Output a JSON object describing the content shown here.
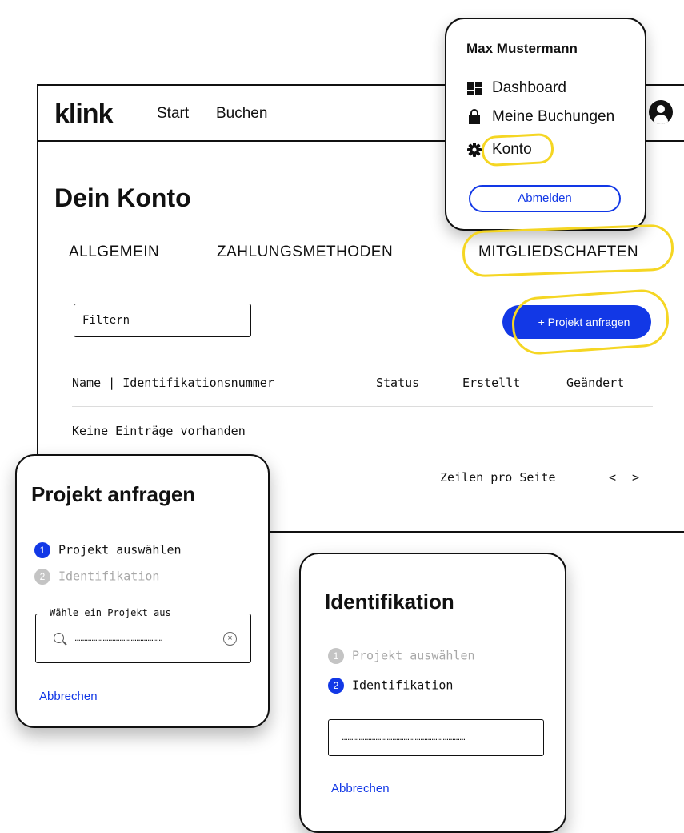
{
  "navbar": {
    "logo": "klink",
    "links": [
      "Start",
      "Buchen"
    ]
  },
  "page": {
    "title": "Dein Konto",
    "tabs": [
      "ALLGEMEIN",
      "ZAHLUNGSMETHODEN",
      "MITGLIEDSCHAFTEN"
    ]
  },
  "toolbar": {
    "filter_placeholder": "Filtern",
    "request_button": "+ Projekt anfragen"
  },
  "table": {
    "columns": [
      "Name | Identifikationsnummer",
      "Status",
      "Erstellt",
      "Geändert"
    ],
    "empty_text": "Keine Einträge vorhanden",
    "rows_per_page_label": "Zeilen pro Seite",
    "prev": "<",
    "next": ">"
  },
  "account_menu": {
    "user_name": "Max Mustermann",
    "items": [
      "Dashboard",
      "Meine Buchungen",
      "Konto"
    ],
    "logout": "Abmelden"
  },
  "request_modal": {
    "title": "Projekt anfragen",
    "steps": [
      {
        "num": "1",
        "label": "Projekt auswählen"
      },
      {
        "num": "2",
        "label": "Identifikation"
      }
    ],
    "select_label": "Wähle ein Projekt aus",
    "select_value": "...............................................",
    "cancel": "Abbrechen"
  },
  "ident_modal": {
    "title": "Identifikation",
    "steps": [
      {
        "num": "1",
        "label": "Projekt auswählen"
      },
      {
        "num": "2",
        "label": "Identifikation"
      }
    ],
    "input_value": "..................................................................",
    "cancel": "Abbrechen"
  },
  "colors": {
    "accent": "#1238e6",
    "highlight": "#f5d623"
  }
}
